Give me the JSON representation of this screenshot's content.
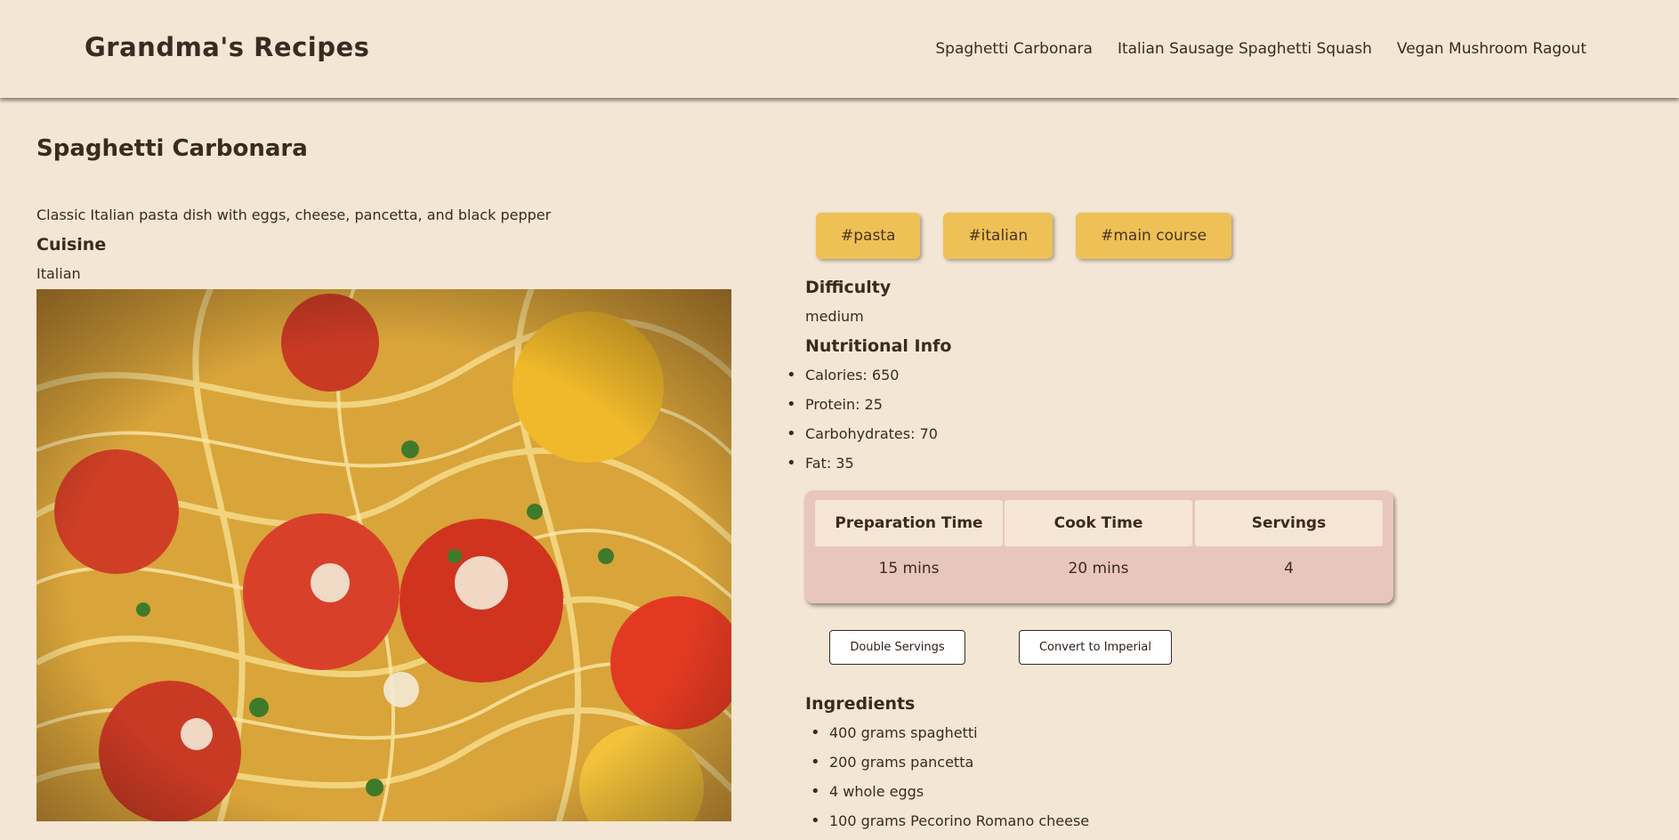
{
  "header": {
    "brand": "Grandma's Recipes",
    "nav": [
      "Spaghetti Carbonara",
      "Italian Sausage Spaghetti Squash",
      "Vegan Mushroom Ragout"
    ]
  },
  "recipe": {
    "title": "Spaghetti Carbonara",
    "description": "Classic Italian pasta dish with eggs, cheese, pancetta, and black pepper",
    "cuisine_label": "Cuisine",
    "cuisine": "Italian",
    "tags": [
      "#pasta",
      "#italian",
      "#main course"
    ],
    "difficulty_label": "Difficulty",
    "difficulty": "medium",
    "nutrition_label": "Nutritional Info",
    "nutrition": [
      "Calories: 650",
      "Protein: 25",
      "Carbohydrates: 70",
      "Fat: 35"
    ],
    "stats": {
      "prep_label": "Preparation Time",
      "cook_label": "Cook Time",
      "servings_label": "Servings",
      "prep": "15 mins",
      "cook": "20 mins",
      "servings": "4"
    },
    "buttons": {
      "double": "Double Servings",
      "convert": "Convert to Imperial"
    },
    "ingredients_label": "Ingredients",
    "ingredients": [
      "400 grams spaghetti",
      "200 grams pancetta",
      "4 whole eggs",
      "100 grams Pecorino Romano cheese"
    ]
  },
  "colors": {
    "background": "#f4e6d4",
    "tag": "#eec156",
    "stats_panel": "#e9c6bd",
    "text": "#3a2a20"
  }
}
